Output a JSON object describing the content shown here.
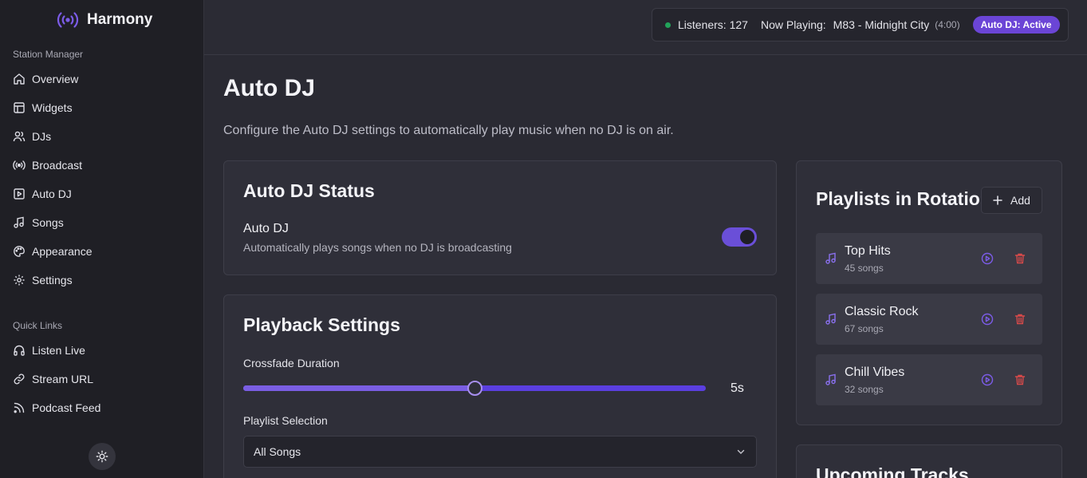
{
  "brand": {
    "name": "Harmony",
    "icon": "broadcast-icon"
  },
  "sidebar": {
    "section1": "Station Manager",
    "items": [
      {
        "label": "Overview",
        "icon": "home-icon"
      },
      {
        "label": "Widgets",
        "icon": "layout-icon"
      },
      {
        "label": "DJs",
        "icon": "users-icon"
      },
      {
        "label": "Broadcast",
        "icon": "radio-icon"
      },
      {
        "label": "Auto DJ",
        "icon": "play-square-icon"
      },
      {
        "label": "Songs",
        "icon": "music-icon"
      },
      {
        "label": "Appearance",
        "icon": "palette-icon"
      },
      {
        "label": "Settings",
        "icon": "gear-icon"
      }
    ],
    "section2": "Quick Links",
    "links": [
      {
        "label": "Listen Live",
        "icon": "headphones-icon"
      },
      {
        "label": "Stream URL",
        "icon": "link-icon"
      },
      {
        "label": "Podcast Feed",
        "icon": "rss-icon"
      }
    ]
  },
  "topbar": {
    "listeners": "Listeners: 127",
    "now_playing_label": "Now Playing:",
    "now_playing_track": "M83 - Midnight City",
    "duration": "(4:00)",
    "badge": "Auto DJ: Active"
  },
  "page": {
    "title": "Auto DJ",
    "description": "Configure the Auto DJ settings to automatically play music when no DJ is on air."
  },
  "status_card": {
    "title": "Auto DJ Status",
    "toggle_label": "Auto DJ",
    "toggle_desc": "Automatically plays songs when no DJ is broadcasting",
    "enabled": true
  },
  "playback": {
    "title": "Playback Settings",
    "crossfade_label": "Crossfade Duration",
    "crossfade_value": "5s",
    "crossfade_fraction": 0.5,
    "playlist_label": "Playlist Selection",
    "playlist_value": "All Songs"
  },
  "rotation": {
    "title": "Playlists in Rotation",
    "add_label": "Add",
    "playlists": [
      {
        "name": "Top Hits",
        "count": "45 songs"
      },
      {
        "name": "Classic Rock",
        "count": "67 songs"
      },
      {
        "name": "Chill Vibes",
        "count": "32 songs"
      }
    ]
  },
  "upcoming": {
    "title": "Upcoming Tracks"
  },
  "colors": {
    "accent": "#6b45d6",
    "danger": "#d94a4a",
    "online": "#22a35a"
  }
}
